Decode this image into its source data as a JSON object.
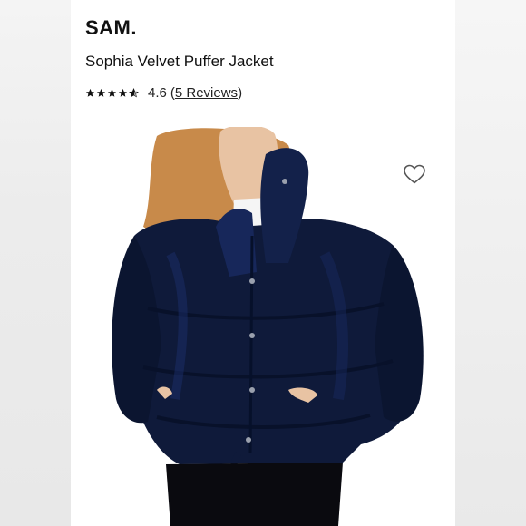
{
  "brand": "SAM.",
  "product": {
    "name": "Sophia Velvet Puffer Jacket"
  },
  "rating": {
    "value": "4.6",
    "reviews_open": "(",
    "reviews_text": "5 Reviews",
    "reviews_close": ")",
    "stars": 4.6
  },
  "image": {
    "description_name": "product-photo",
    "jacket_color": "#0f1a3a",
    "hair_color": "#c88a4a"
  },
  "icons": {
    "wishlist": "heart-icon"
  }
}
